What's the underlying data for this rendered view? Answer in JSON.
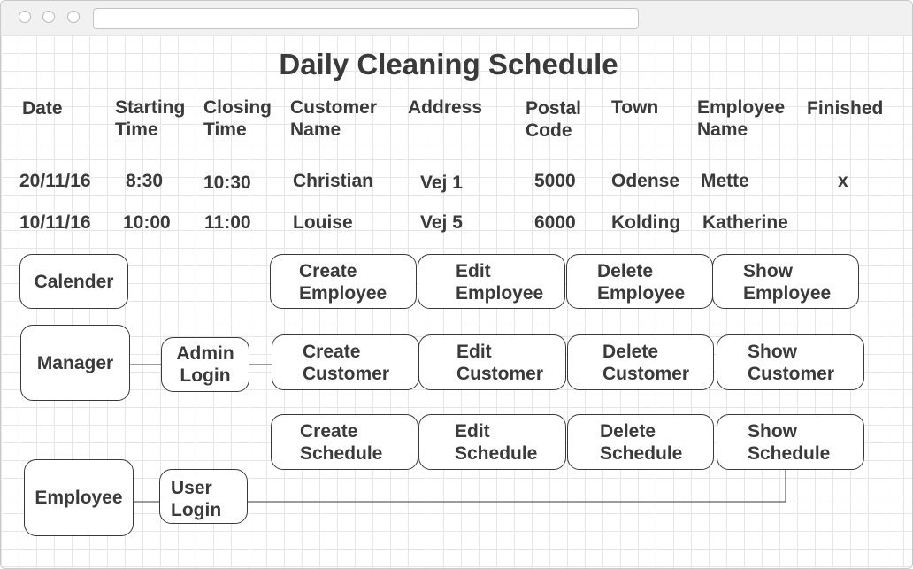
{
  "window": {
    "url": ""
  },
  "title": "Daily Cleaning Schedule",
  "table": {
    "headers": [
      "Date",
      "Starting\nTime",
      "Closing\nTime",
      "Customer\nName",
      "Address",
      "Postal\nCode",
      "Town",
      "Employee\nName",
      "Finished"
    ],
    "rows": [
      [
        "20/11/16",
        "8:30",
        "10:30",
        "Christian",
        "Vej 1",
        "5000",
        "Odense",
        "Mette",
        "x"
      ],
      [
        "10/11/16",
        "10:00",
        "11:00",
        "Louise",
        "Vej 5",
        "6000",
        "Kolding",
        "Katherine",
        ""
      ]
    ]
  },
  "nav": {
    "calender": "Calender",
    "manager": "Manager",
    "admin_login": "Admin\nLogin",
    "employee": "Employee",
    "user_login": "User\nLogin"
  },
  "actions": {
    "employee": [
      "Create\nEmployee",
      "Edit\nEmployee",
      "Delete\nEmployee",
      "Show\nEmployee"
    ],
    "customer": [
      "Create\nCustomer",
      "Edit\nCustomer",
      "Delete\nCustomer",
      "Show\nCustomer"
    ],
    "schedule": [
      "Create\nSchedule",
      "Edit\nSchedule",
      "Delete\nSchedule",
      "Show\nSchedule"
    ]
  }
}
